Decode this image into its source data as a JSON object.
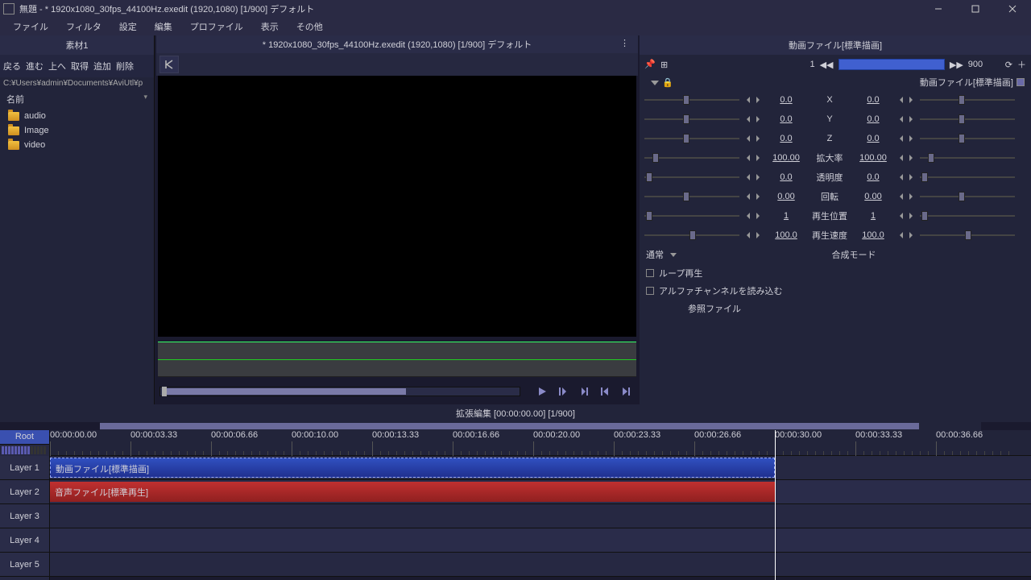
{
  "window": {
    "title": "無題 - * 1920x1080_30fps_44100Hz.exedit (1920,1080)  [1/900]  デフォルト"
  },
  "menu": [
    "ファイル",
    "フィルタ",
    "設定",
    "編集",
    "プロファイル",
    "表示",
    "その他"
  ],
  "sidebar": {
    "title": "素材1",
    "nav": [
      "戻る",
      "進む",
      "上へ",
      "取得",
      "追加",
      "削除"
    ],
    "path": "C:¥Users¥admin¥Documents¥AviUtl¥p",
    "header": "名前",
    "folders": [
      "audio",
      "Image",
      "video"
    ]
  },
  "preview": {
    "title": "* 1920x1080_30fps_44100Hz.exedit (1920,1080)  [1/900]  デフォルト"
  },
  "props": {
    "title": "動画ファイル[標準描画]",
    "frameStart": "1",
    "frameEnd": "900",
    "sublabel": "動画ファイル[標準描画]",
    "params": [
      {
        "label": "X",
        "l": "0.0",
        "r": "0.0",
        "lp": 48,
        "rp": 48
      },
      {
        "label": "Y",
        "l": "0.0",
        "r": "0.0",
        "lp": 48,
        "rp": 48
      },
      {
        "label": "Z",
        "l": "0.0",
        "r": "0.0",
        "lp": 48,
        "rp": 48
      },
      {
        "label": "拡大率",
        "l": "100.00",
        "r": "100.00",
        "lp": 10,
        "rp": 10
      },
      {
        "label": "透明度",
        "l": "0.0",
        "r": "0.0",
        "lp": 2,
        "rp": 2
      },
      {
        "label": "回転",
        "l": "0.00",
        "r": "0.00",
        "lp": 48,
        "rp": 48
      },
      {
        "label": "再生位置",
        "l": "1",
        "r": "1",
        "lp": 2,
        "rp": 2
      },
      {
        "label": "再生速度",
        "l": "100.0",
        "r": "100.0",
        "lp": 56,
        "rp": 56
      }
    ],
    "blendValue": "通常",
    "blendLabel": "合成モード",
    "loop": "ループ再生",
    "alpha": "アルファチャンネルを読み込む",
    "reffile": "参照ファイル"
  },
  "timeline": {
    "title": "拡張編集 [00:00:00.00] [1/900]",
    "root": "Root",
    "layers": [
      "Layer 1",
      "Layer 2",
      "Layer 3",
      "Layer 4",
      "Layer 5"
    ],
    "ticks": [
      "00:00:00.00",
      "00:00:03.33",
      "00:00:06.66",
      "00:00:10.00",
      "00:00:13.33",
      "00:00:16.66",
      "00:00:20.00",
      "00:00:23.33",
      "00:00:26.66",
      "00:00:30.00",
      "00:00:33.33",
      "00:00:36.66"
    ],
    "clip1": "動画ファイル[標準描画]",
    "clip2": "音声ファイル[標準再生]"
  }
}
